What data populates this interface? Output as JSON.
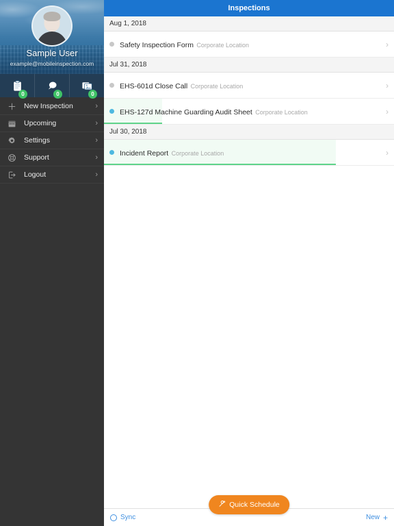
{
  "sidebar": {
    "profile": {
      "name": "Sample User",
      "email": "example@mobileinspection.com",
      "avatar_icon": "user-avatar-placeholder"
    },
    "quick_icons": [
      {
        "icon": "clipboard-icon",
        "badge": "0"
      },
      {
        "icon": "speech-bubble-icon",
        "badge": "0"
      },
      {
        "icon": "photo-icon",
        "badge": "0"
      }
    ],
    "badge_color": "#3fc366",
    "menu": [
      {
        "label": "New Inspection",
        "icon": "plus-icon",
        "chevron": "›"
      },
      {
        "label": "Upcoming",
        "icon": "calendar-icon",
        "chevron": "›"
      },
      {
        "label": "Settings",
        "icon": "gear-icon",
        "chevron": "›"
      },
      {
        "label": "Support",
        "icon": "lifebuoy-icon",
        "chevron": "›"
      },
      {
        "label": "Logout",
        "icon": "logout-icon",
        "chevron": "›"
      }
    ]
  },
  "header": {
    "title": "Inspections",
    "background_color": "#1b75d0"
  },
  "list": {
    "groups": [
      {
        "date": "Aug 1, 2018",
        "rows": [
          {
            "title": "Safety Inspection Form",
            "subtitle": "Corporate Location",
            "dot_color": "#c8c8c8",
            "progress_percent": 0,
            "highlight_percent": 0,
            "chevron": "›"
          }
        ]
      },
      {
        "date": "Jul 31, 2018",
        "rows": [
          {
            "title": "EHS-601d Close Call",
            "subtitle": "Corporate Location",
            "dot_color": "#c8c8c8",
            "progress_percent": 0,
            "highlight_percent": 0,
            "chevron": "›"
          },
          {
            "title": "EHS-127d Machine Guarding Audit Sheet",
            "subtitle": "Corporate Location",
            "dot_color": "#4eb8e0",
            "progress_percent": 20,
            "highlight_percent": 20,
            "chevron": "›"
          }
        ]
      },
      {
        "date": "Jul 30, 2018",
        "rows": [
          {
            "title": "Incident Report",
            "subtitle": "Corporate Location",
            "dot_color": "#4eb8e0",
            "progress_percent": 80,
            "highlight_percent": 80,
            "chevron": "›"
          }
        ]
      }
    ],
    "progress_color": "#5fd48a",
    "highlight_color": "#f1fbf4"
  },
  "bottombar": {
    "sync_label": "Sync",
    "sync_icon": "sync-circle-icon",
    "new_label": "New",
    "new_icon": "plus-icon",
    "accent_color": "#3f8fe0"
  },
  "fab": {
    "label": "Quick Schedule",
    "icon": "tools-icon",
    "color": "#f0861f"
  }
}
